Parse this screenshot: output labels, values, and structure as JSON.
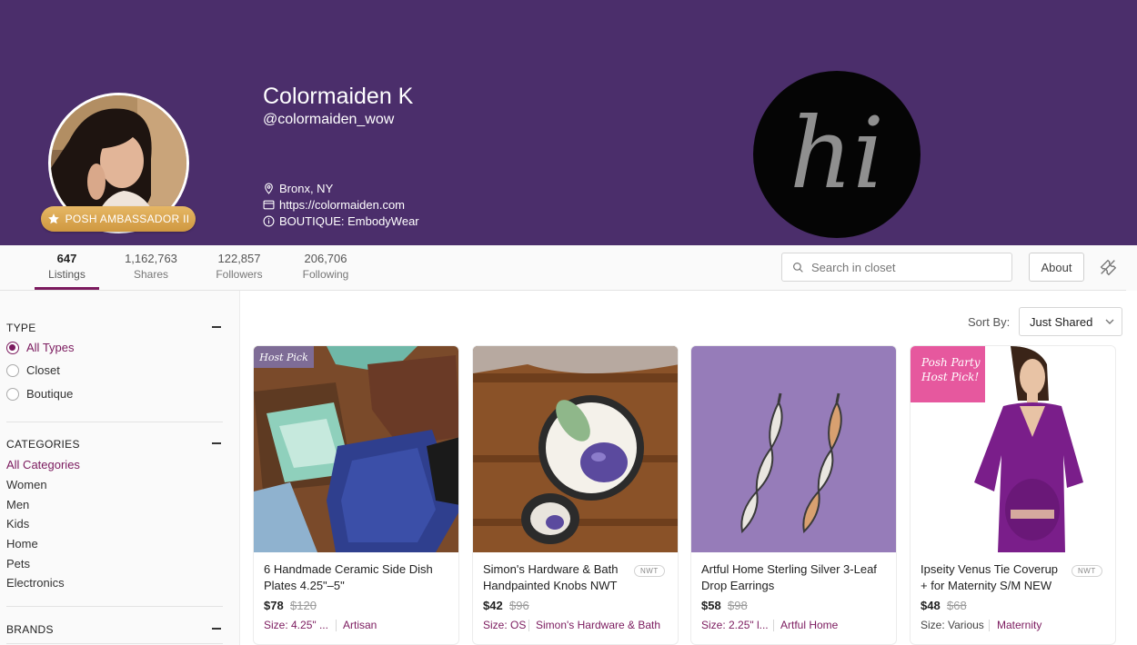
{
  "profile": {
    "display_name": "Colormaiden K",
    "username": "@colormaiden_wow",
    "location": "Bronx, NY",
    "website": "https://colormaiden.com",
    "boutique": "BOUTIQUE: EmbodyWear",
    "badge_label": "POSH AMBASSADOR II",
    "logo_text": "hi"
  },
  "stats": [
    {
      "value": "647",
      "label": "Listings"
    },
    {
      "value": "1,162,763",
      "label": "Shares"
    },
    {
      "value": "122,857",
      "label": "Followers"
    },
    {
      "value": "206,706",
      "label": "Following"
    }
  ],
  "search": {
    "placeholder": "Search in closet"
  },
  "about_label": "About",
  "filters": {
    "type": {
      "title": "TYPE",
      "options": [
        "All Types",
        "Closet",
        "Boutique"
      ],
      "selected": "All Types"
    },
    "categories": {
      "title": "CATEGORIES",
      "items": [
        "All Categories",
        "Women",
        "Men",
        "Kids",
        "Home",
        "Pets",
        "Electronics"
      ],
      "selected": "All Categories"
    },
    "brands": {
      "title": "BRANDS"
    }
  },
  "sort": {
    "label": "Sort By:",
    "value": "Just Shared"
  },
  "listings": [
    {
      "title": "6 Handmade Ceramic Side Dish Plates 4.25\"–5\"",
      "price": "$78",
      "original_price": "$120",
      "size": "Size: 4.25\" ...",
      "brand": "Artisan",
      "nwt": "",
      "badge": "Host Pick"
    },
    {
      "title": "Simon's Hardware & Bath Handpainted Knobs NWT",
      "price": "$42",
      "original_price": "$96",
      "size": "Size: OS",
      "brand": "Simon's Hardware & Bath",
      "nwt": "NWT",
      "badge": ""
    },
    {
      "title": "Artful Home Sterling Silver 3-Leaf Drop Earrings",
      "price": "$58",
      "original_price": "$98",
      "size": "Size: 2.25\" l...",
      "brand": "Artful Home",
      "nwt": "",
      "badge": ""
    },
    {
      "title": "Ipseity Venus Tie Coverup + for Maternity S/M NEW",
      "price": "$48",
      "original_price": "$68",
      "size": "Size: Various",
      "brand": "Maternity",
      "nwt": "NWT",
      "badge_line1": "Posh Party",
      "badge_line2": "Host Pick!"
    }
  ],
  "colors": {
    "cover": "#4b2e6b",
    "accent": "#7b1a5e",
    "badge_gold": "#d9a24a"
  }
}
